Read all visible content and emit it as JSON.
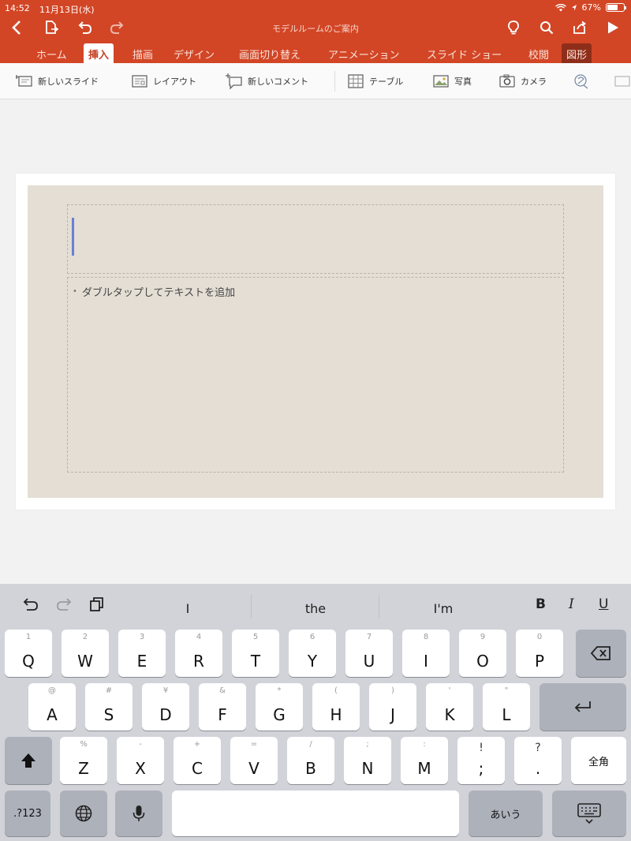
{
  "status_bar": {
    "time": "14:52",
    "date": "11月13日(水)",
    "battery": "67%"
  },
  "document": {
    "title": "モデルルームのご案内"
  },
  "tabs": [
    "ホーム",
    "挿入",
    "描画",
    "デザイン",
    "画面切り替え",
    "アニメーション",
    "スライド ショー",
    "校閲",
    "図形"
  ],
  "active_tab": "挿入",
  "ribbon": {
    "new_slide": "新しいスライド",
    "layout": "レイアウト",
    "new_comment": "新しいコメント",
    "table": "テーブル",
    "photo": "写真",
    "camera": "カメラ"
  },
  "slide": {
    "body_placeholder": "ダブルタップしてテキストを追加"
  },
  "keyboard": {
    "suggestions": [
      "I",
      "the",
      "I'm"
    ],
    "format": {
      "bold": "B",
      "italic": "I",
      "underline": "U"
    },
    "row1": [
      {
        "main": "Q",
        "sub": "1"
      },
      {
        "main": "W",
        "sub": "2"
      },
      {
        "main": "E",
        "sub": "3"
      },
      {
        "main": "R",
        "sub": "4"
      },
      {
        "main": "T",
        "sub": "5"
      },
      {
        "main": "Y",
        "sub": "6"
      },
      {
        "main": "U",
        "sub": "7"
      },
      {
        "main": "I",
        "sub": "8"
      },
      {
        "main": "O",
        "sub": "9"
      },
      {
        "main": "P",
        "sub": "0"
      }
    ],
    "row2": [
      {
        "main": "A",
        "sub": "@"
      },
      {
        "main": "S",
        "sub": "#"
      },
      {
        "main": "D",
        "sub": "¥"
      },
      {
        "main": "F",
        "sub": "&"
      },
      {
        "main": "G",
        "sub": "*"
      },
      {
        "main": "H",
        "sub": "("
      },
      {
        "main": "J",
        "sub": ")"
      },
      {
        "main": "K",
        "sub": "'"
      },
      {
        "main": "L",
        "sub": "\""
      }
    ],
    "row3": [
      {
        "main": "Z",
        "sub": "%"
      },
      {
        "main": "X",
        "sub": "-"
      },
      {
        "main": "C",
        "sub": "+"
      },
      {
        "main": "V",
        "sub": "="
      },
      {
        "main": "B",
        "sub": "/"
      },
      {
        "main": "N",
        "sub": ";"
      },
      {
        "main": "M",
        "sub": ":"
      },
      {
        "main": ";",
        "sub": "!"
      },
      {
        "main": ".",
        "sub": "?"
      }
    ],
    "zenkaku": "全角",
    "num_key": ".?123",
    "kana_key": "あいう"
  }
}
